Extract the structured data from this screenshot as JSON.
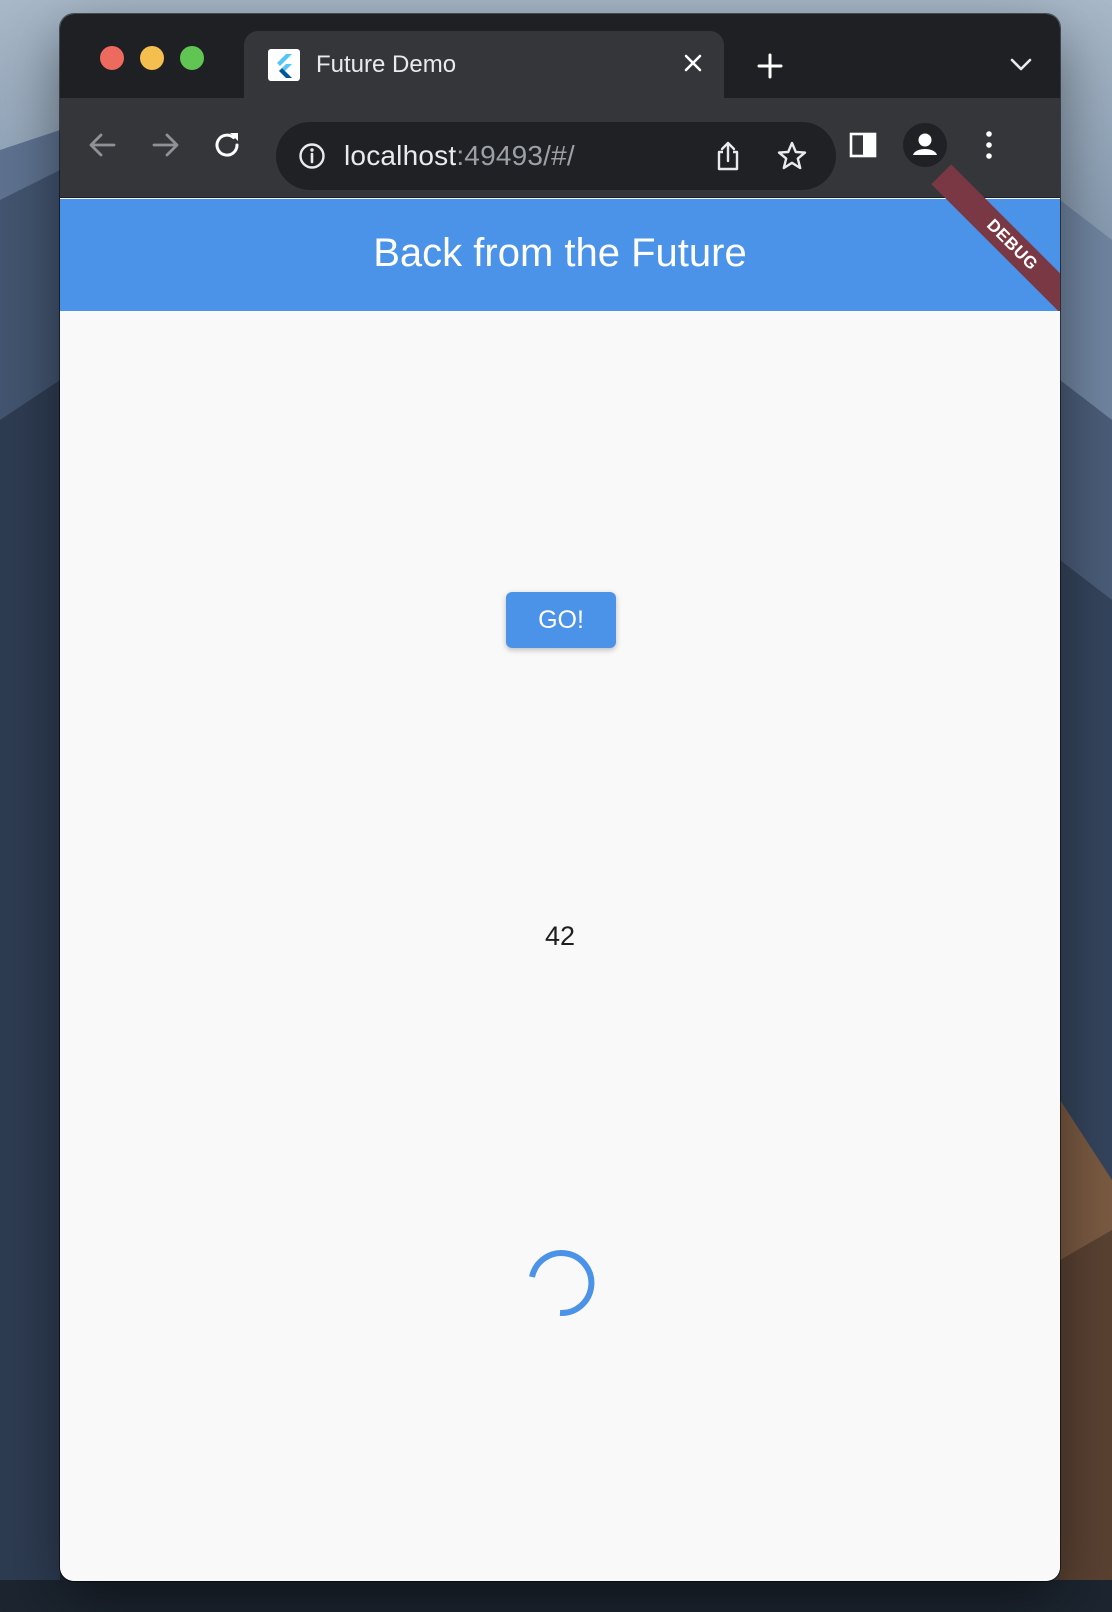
{
  "browser": {
    "tab": {
      "title": "Future Demo",
      "favicon": "flutter-logo-icon"
    },
    "address": {
      "host": "localhost",
      "rest": ":49493/#/"
    },
    "colors": {
      "frame": "#1f2023",
      "toolbar": "#35363a",
      "omnibox": "#202124"
    }
  },
  "app": {
    "title": "Back from the Future",
    "debug_banner": "DEBUG",
    "go_button": "GO!",
    "result": "42",
    "loading_indicator": "circular-progress-icon",
    "colors": {
      "primary": "#4a93e8",
      "debug": "#7a3845",
      "background": "#f9f9f9"
    }
  }
}
